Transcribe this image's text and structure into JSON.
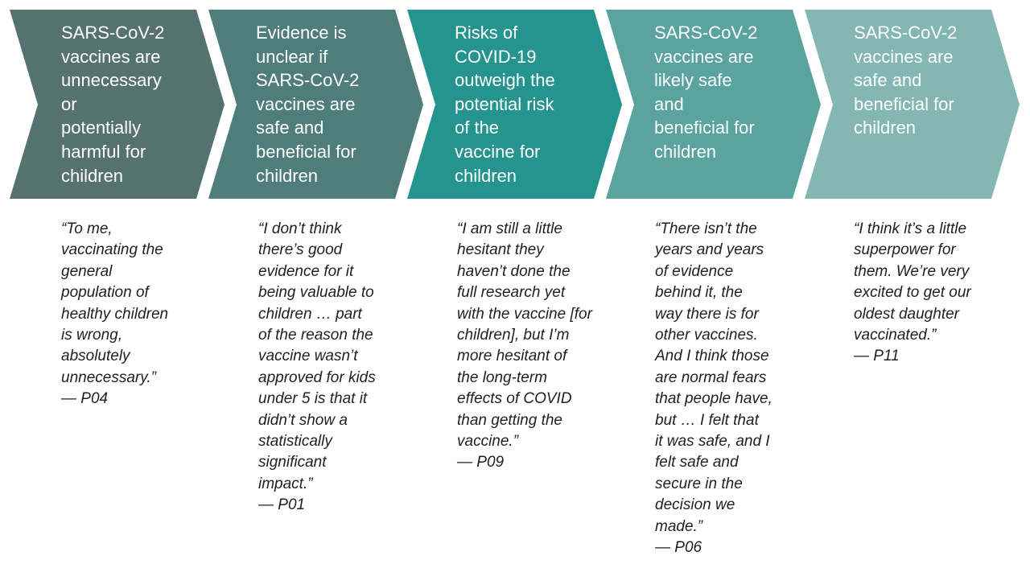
{
  "stages": [
    {
      "label": "SARS-CoV-2\nvaccines are\nunnecessary\nor\npotentially\nharmful for\nchildren",
      "color": "#557170",
      "quote": "“To me,\nvaccinating the\ngeneral\npopulation of\nhealthy children\nis wrong,\nabsolutely\nunnecessary.”",
      "attribution": "— P04"
    },
    {
      "label": "Evidence is\nunclear if\nSARS-CoV-2\nvaccines are\nsafe and\nbeneficial for\nchildren",
      "color": "#4f7d7b",
      "quote": "“I don’t think\nthere’s good\nevidence for it\nbeing valuable to\nchildren … part\nof  the reason the\nvaccine wasn’t\napproved for kids\nunder 5 is that it\ndidn’t show a\nstatistically\nsignificant\nimpact.”",
      "attribution": "— P01"
    },
    {
      "label": "Risks of\nCOVID-19\noutweigh the\npotential risk\nof the\nvaccine for\nchildren",
      "color": "#25938e",
      "quote": "“I am still a little\nhesitant they\nhaven’t done the\nfull research yet\nwith the vaccine [for\nchildren], but I’m\nmore hesitant of\nthe long-term\neffects of COVID\nthan getting the\nvaccine.”",
      "attribution": "— P09"
    },
    {
      "label": "SARS-CoV-2\nvaccines are\nlikely safe\nand\nbeneficial for\nchildren",
      "color": "#5aa39f",
      "quote": "“There isn’t the\nyears and years\nof evidence\nbehind it, the\nway there is for\nother vaccines.\nAnd I think those\nare normal fears\nthat people have,\nbut … I felt that\nit was safe, and I\nfelt safe and\nsecure in the\ndecision we\nmade.”",
      "attribution": "— P06"
    },
    {
      "label": "SARS-CoV-2\nvaccines are\nsafe and\nbeneficial for\nchildren",
      "color": "#84b6b3",
      "quote": "“I think it’s a little\nsuperpower for\nthem. We’re very\nexcited to get our\noldest daughter\nvaccinated.”",
      "attribution": "— P11"
    }
  ]
}
